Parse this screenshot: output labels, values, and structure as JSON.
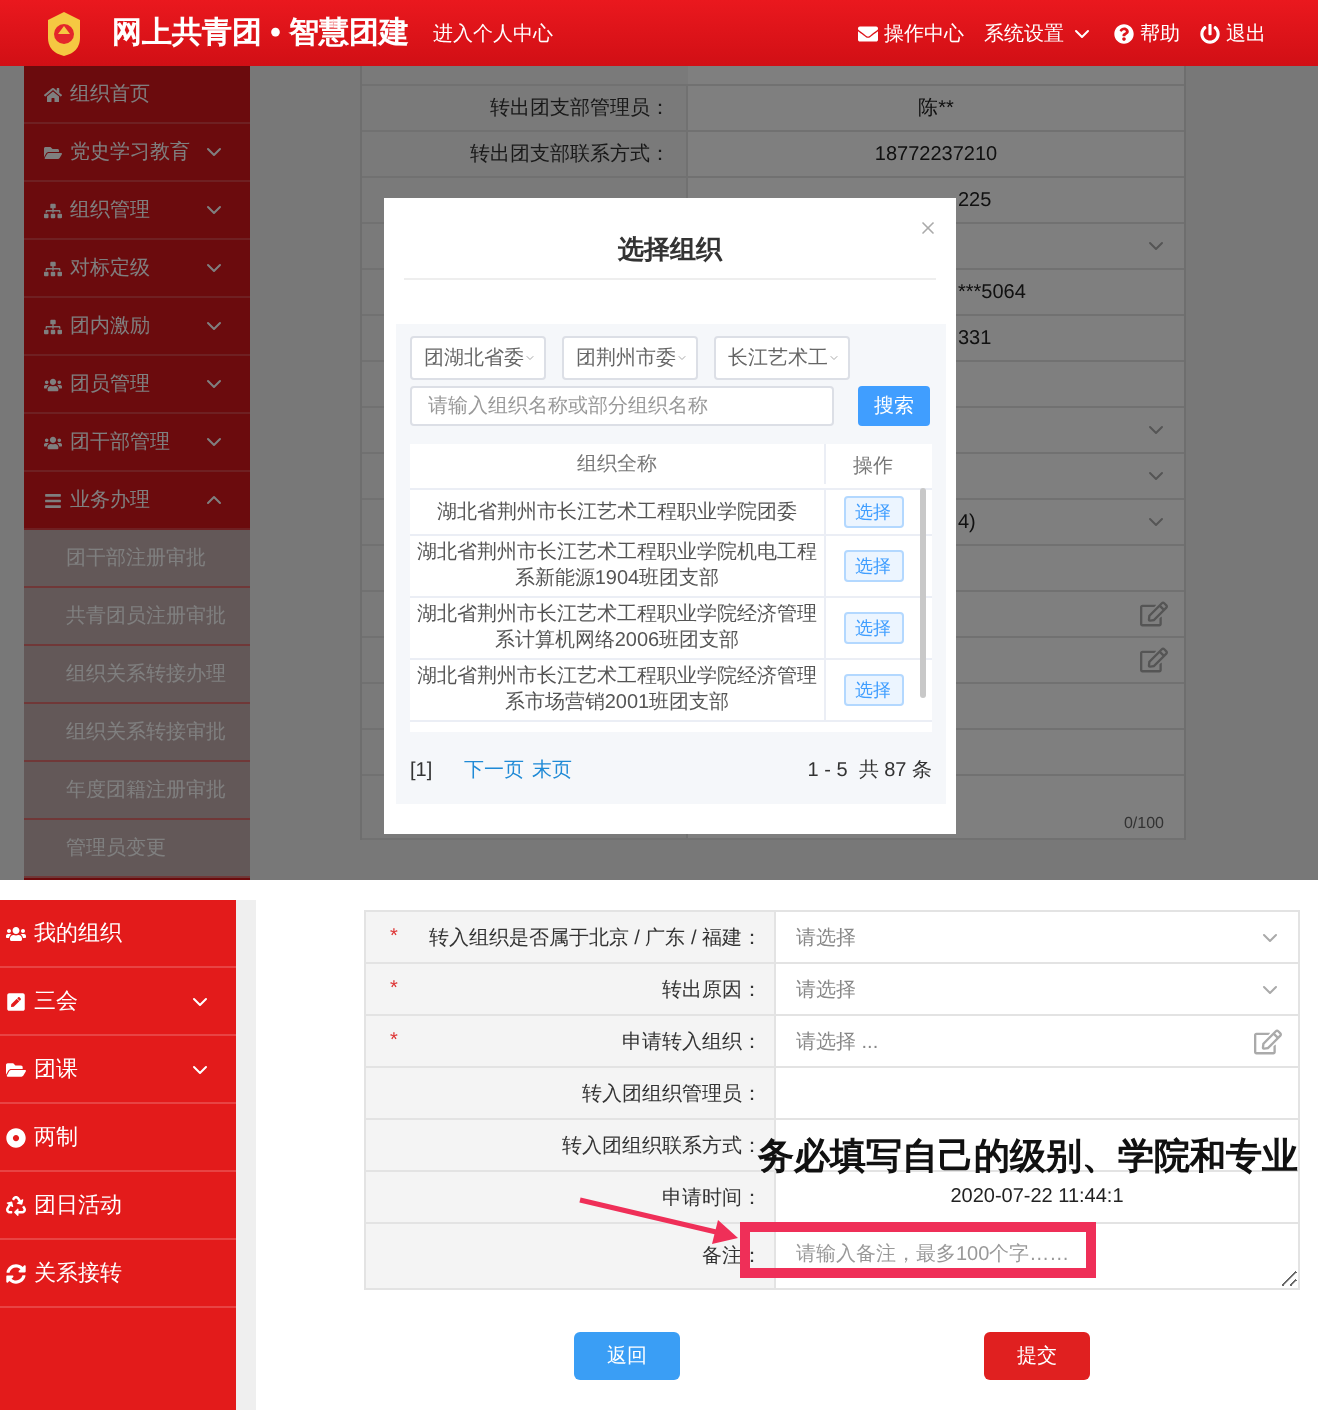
{
  "top_screen": {
    "header": {
      "title": "网上共青团 • 智慧团建",
      "link": "进入个人中心",
      "actions": [
        {
          "kind": "mail",
          "label": "操作中心"
        },
        {
          "kind": "dropdown",
          "label": "系统设置"
        },
        {
          "kind": "help",
          "label": "帮助"
        },
        {
          "kind": "logout",
          "label": "退出"
        }
      ]
    },
    "sidebar": [
      {
        "label": "组织首页",
        "kind": "link"
      },
      {
        "label": "党史学习教育",
        "kind": "group",
        "expanded": false
      },
      {
        "label": "组织管理",
        "kind": "group",
        "expanded": false
      },
      {
        "label": "对标定级",
        "kind": "group",
        "expanded": false
      },
      {
        "label": "团内激励",
        "kind": "group",
        "expanded": false
      },
      {
        "label": "团员管理",
        "kind": "group",
        "expanded": false
      },
      {
        "label": "团干部管理",
        "kind": "group",
        "expanded": false
      },
      {
        "label": "业务办理",
        "kind": "group",
        "expanded": true,
        "children": [
          {
            "label": "团干部注册审批"
          },
          {
            "label": "共青团员注册审批"
          },
          {
            "label": "组织关系转接办理"
          },
          {
            "label": "组织关系转接审批"
          },
          {
            "label": "年度团籍注册审批"
          },
          {
            "label": "管理员变更"
          }
        ]
      }
    ],
    "form_rows": [
      {
        "label": "转出团支部管理员：",
        "value": "陈**",
        "kind": "text"
      },
      {
        "label": "转出团支部联系方式：",
        "value": "18772237210",
        "kind": "text"
      },
      {
        "value": "225",
        "kind": "text"
      },
      {
        "kind": "select"
      },
      {
        "value": "***5064",
        "kind": "text"
      },
      {
        "value": "331",
        "kind": "text"
      },
      {
        "kind": "text"
      },
      {
        "kind": "select"
      },
      {
        "kind": "select"
      },
      {
        "value": "4)",
        "kind": "select"
      },
      {
        "kind": "text"
      },
      {
        "kind": "edit"
      },
      {
        "kind": "edit"
      },
      {
        "kind": "text"
      },
      {
        "kind": "text"
      },
      {
        "kind": "textarea",
        "counter": "0/100"
      }
    ],
    "dialog": {
      "title": "选择组织",
      "selects": [
        "团湖北省委",
        "团荆州市委",
        "长江艺术工"
      ],
      "search": {
        "placeholder": "请输入组织名称或部分组织名称",
        "button": "搜索"
      },
      "columns": [
        "组织全称",
        "操作"
      ],
      "rows": [
        {
          "name": "湖北省荆州市长江艺术工程职业学院团委",
          "action": "选择"
        },
        {
          "name": "湖北省荆州市长江艺术工程职业学院机电工程系新能源1904班团支部",
          "action": "选择"
        },
        {
          "name": "湖北省荆州市长江艺术工程职业学院经济管理系计算机网络2006班团支部",
          "action": "选择"
        },
        {
          "name": "湖北省荆州市长江艺术工程职业学院经济管理系市场营销2001班团支部",
          "action": "选择"
        }
      ],
      "pagination": {
        "current": "[1]",
        "links": [
          "下一页",
          "末页"
        ],
        "summary": "1 - 5  共 87 条"
      }
    }
  },
  "bottom_screen": {
    "sidebar": [
      {
        "label": "我的组织",
        "kind": "link"
      },
      {
        "label": "三会",
        "kind": "group",
        "expanded": false
      },
      {
        "label": "团课",
        "kind": "group",
        "expanded": false
      },
      {
        "label": "两制",
        "kind": "link"
      },
      {
        "label": "团日活动",
        "kind": "link"
      },
      {
        "label": "关系接转",
        "kind": "link"
      }
    ],
    "form_rows": [
      {
        "mark": "*",
        "label": "转入组织是否属于北京 / 广东 / 福建：",
        "kind": "select",
        "placeholder": "请选择"
      },
      {
        "mark": "*",
        "label": "转出原因：",
        "kind": "select",
        "placeholder": "请选择"
      },
      {
        "mark": "*",
        "label": "申请转入组织：",
        "kind": "edit",
        "placeholder": "请选择 ..."
      },
      {
        "label": "转入团组织管理员：",
        "kind": "text"
      },
      {
        "label": "转入团组织联系方式：",
        "kind": "text"
      },
      {
        "label": "申请时间：",
        "kind": "text",
        "value": "2020-07-22 11:44:1"
      },
      {
        "label": "备注：",
        "kind": "textarea",
        "placeholder": "请输入备注，最多100个字……"
      }
    ],
    "buttons": [
      {
        "kind": "back",
        "label": "返回"
      },
      {
        "kind": "submit",
        "label": "提交"
      }
    ]
  },
  "annotation": {
    "text": "务必填写自己的级别、学院和专业"
  }
}
